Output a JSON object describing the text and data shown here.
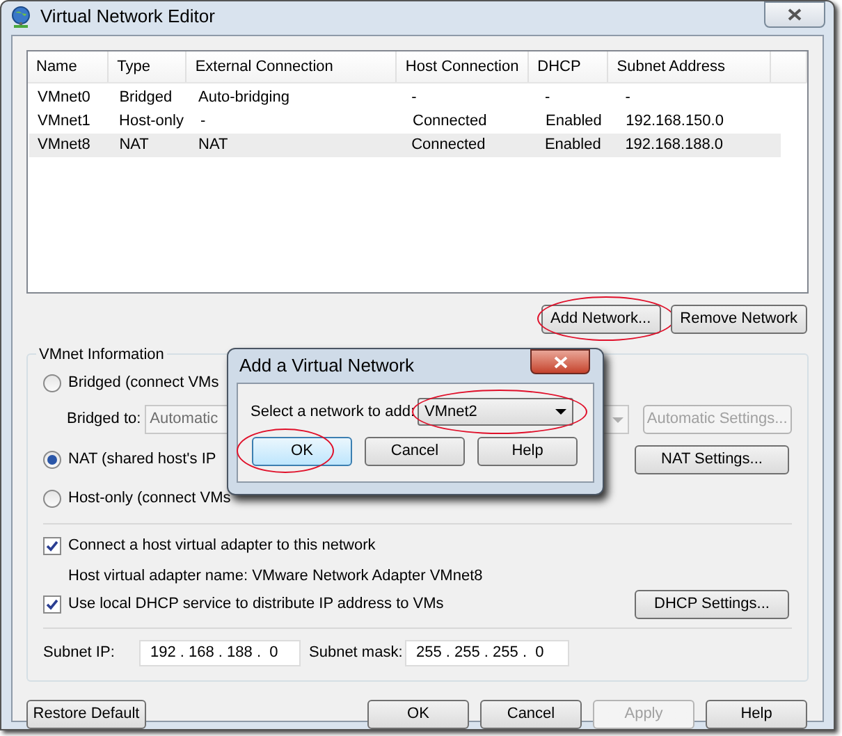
{
  "window": {
    "title": "Virtual Network Editor"
  },
  "table": {
    "columns": [
      "Name",
      "Type",
      "External Connection",
      "Host Connection",
      "DHCP",
      "Subnet Address"
    ],
    "rows": [
      {
        "cells": [
          "VMnet0",
          "Bridged",
          "Auto-bridging",
          "-",
          "-",
          "-"
        ],
        "selected": false
      },
      {
        "cells": [
          "VMnet1",
          "Host-only",
          "-",
          "Connected",
          "Enabled",
          "192.168.150.0"
        ],
        "selected": false
      },
      {
        "cells": [
          "VMnet8",
          "NAT",
          "NAT",
          "Connected",
          "Enabled",
          "192.168.188.0"
        ],
        "selected": true
      }
    ]
  },
  "list_buttons": [
    {
      "label": "Add Network...",
      "highlighted": true
    },
    {
      "label": "Remove Network",
      "highlighted": false
    }
  ],
  "vmnet_info": {
    "title": "VMnet Information",
    "bridged": {
      "label": "Bridged (connect VMs",
      "selected": false
    },
    "bridged_to": {
      "label": "Bridged to:",
      "value": "Automatic",
      "disabled": true
    },
    "automatic_settings": {
      "label": "Automatic Settings...",
      "disabled": true
    },
    "nat": {
      "label": "NAT (shared host's IP",
      "selected": true
    },
    "nat_settings": {
      "label": "NAT Settings...",
      "disabled": false
    },
    "host_only": {
      "label": "Host-only (connect VMs",
      "selected": false
    },
    "connect_adapter": {
      "label": "Connect a host virtual adapter to this network",
      "checked": true
    },
    "adapter_name": "Host virtual adapter name: VMware Network Adapter VMnet8",
    "dhcp": {
      "label": "Use local DHCP service to distribute IP address to VMs",
      "checked": true
    },
    "dhcp_settings": {
      "label": "DHCP Settings...",
      "disabled": false
    },
    "subnet_ip": {
      "label": "Subnet IP:",
      "value": "192 . 168 . 188 .  0"
    },
    "subnet_mask": {
      "label": "Subnet mask:",
      "value": "255 . 255 . 255 .  0"
    }
  },
  "footer": {
    "restore": {
      "label": "Restore Default",
      "disabled": false
    },
    "buttons": [
      {
        "label": "OK",
        "disabled": false
      },
      {
        "label": "Cancel",
        "disabled": false
      },
      {
        "label": "Apply",
        "disabled": true
      },
      {
        "label": "Help",
        "disabled": false
      }
    ]
  },
  "dialog": {
    "title": "Add a Virtual Network",
    "field_label": "Select a network to add:",
    "combo": {
      "value": "VMnet2",
      "highlighted": true
    },
    "buttons": [
      {
        "label": "OK",
        "highlighted": true,
        "default": true
      },
      {
        "label": "Cancel",
        "highlighted": false,
        "default": false
      },
      {
        "label": "Help",
        "highlighted": false,
        "default": false
      }
    ]
  }
}
